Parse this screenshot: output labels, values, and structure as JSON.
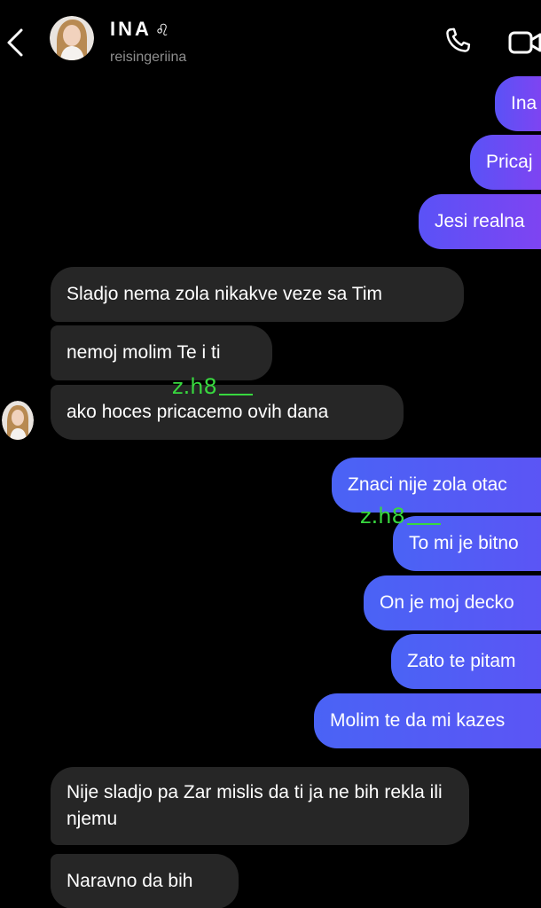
{
  "header": {
    "name": "INA",
    "zodiac": "♌",
    "handle": "reisingeriina"
  },
  "watermark": {
    "text": "z.h8"
  },
  "messages": [
    {
      "side": "out",
      "text": "Ina"
    },
    {
      "side": "out",
      "text": "Pricaj"
    },
    {
      "side": "out",
      "text": "Jesi realna"
    },
    {
      "side": "in",
      "text": "Sladjo nema zola nikakve veze sa Tim"
    },
    {
      "side": "in",
      "text": "nemoj molim Te i ti"
    },
    {
      "side": "in",
      "text": "ako hoces pricacemo ovih dana"
    },
    {
      "side": "out",
      "text": "Znaci nije zola otac"
    },
    {
      "side": "out",
      "text": "To mi je bitno"
    },
    {
      "side": "out",
      "text": "On je moj decko"
    },
    {
      "side": "out",
      "text": "Zato te pitam"
    },
    {
      "side": "out",
      "text": "Molim te da mi kazes"
    },
    {
      "side": "in",
      "text": "Nije sladjo pa Zar mislis da ti ja ne bih rekla ili njemu"
    },
    {
      "side": "in",
      "text": "Naravno da bih"
    }
  ]
}
